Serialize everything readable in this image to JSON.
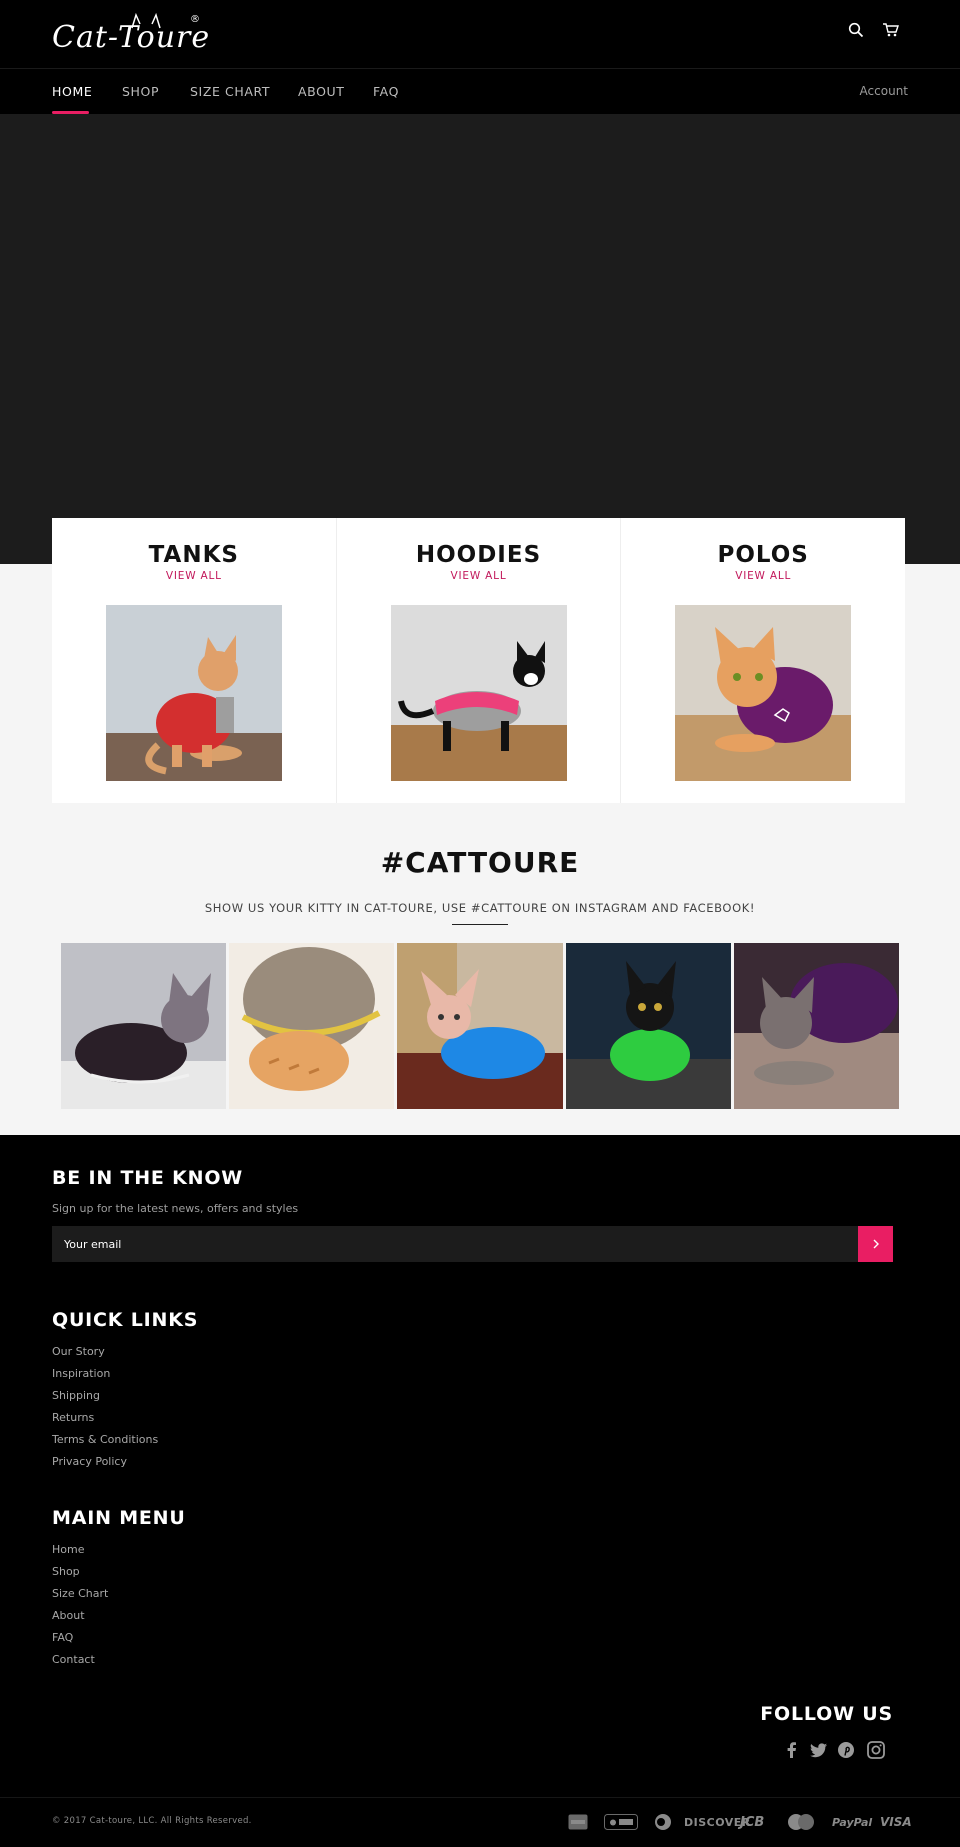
{
  "header": {
    "logo_text": "Cat-Toure",
    "logo_reg": "®",
    "search_icon": "search-icon",
    "cart_icon": "cart-icon"
  },
  "nav": {
    "items": [
      {
        "label": "HOME",
        "active": true
      },
      {
        "label": "SHOP"
      },
      {
        "label": "SIZE CHART"
      },
      {
        "label": "ABOUT"
      },
      {
        "label": "FAQ"
      }
    ],
    "account": "Account",
    "accent": "#e91e63"
  },
  "categories": [
    {
      "title": "TANKS",
      "link": "VIEW ALL"
    },
    {
      "title": "HOODIES",
      "link": "VIEW ALL"
    },
    {
      "title": "POLOS",
      "link": "VIEW ALL"
    }
  ],
  "instagram": {
    "title": "#CATTOURE",
    "subtitle": "SHOW US YOUR KITTY IN CAT-TOURE, USE #CATTOURE ON INSTAGRAM AND FACEBOOK!"
  },
  "newsletter": {
    "title": "BE IN THE KNOW",
    "text": "Sign up for the latest news, offers and styles",
    "placeholder": "Your email"
  },
  "quick_links": {
    "title": "QUICK LINKS",
    "items": [
      "Our Story",
      "Inspiration",
      "Shipping",
      "Returns",
      "Terms & Conditions",
      "Privacy Policy"
    ]
  },
  "main_menu": {
    "title": "MAIN MENU",
    "items": [
      "Home",
      "Shop",
      "Size Chart",
      "About",
      "FAQ",
      "Contact"
    ]
  },
  "follow": {
    "title": "FOLLOW US",
    "icons": [
      "facebook-icon",
      "twitter-icon",
      "pinterest-icon",
      "instagram-icon"
    ]
  },
  "copyright": "© 2017 Cat-toure, LLC. All Rights Reserved.",
  "payments": [
    "American Express",
    "Apple Pay",
    "Diners Club",
    "DISCOVER",
    "JCB",
    "MasterCard",
    "PayPal",
    "VISA"
  ]
}
